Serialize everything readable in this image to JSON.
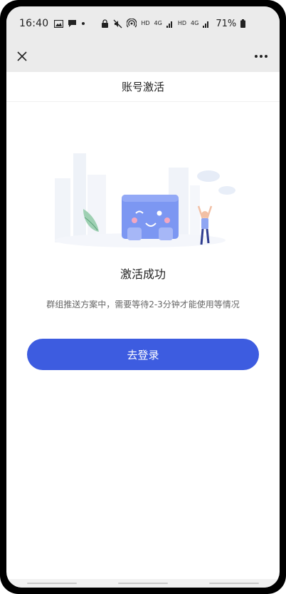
{
  "status_bar": {
    "time": "16:40",
    "battery": "71%",
    "network_label_1": "HD",
    "network_label_2": "4G",
    "network_label_3": "HD",
    "network_label_4": "4G"
  },
  "page": {
    "title": "账号激活"
  },
  "result": {
    "title": "激活成功",
    "description": "群组推送方案中，需要等待2-3分钟才能使用等情况",
    "login_button": "去登录"
  },
  "colors": {
    "primary": "#3d5ce0",
    "status_bar_bg": "#ebebeb"
  }
}
